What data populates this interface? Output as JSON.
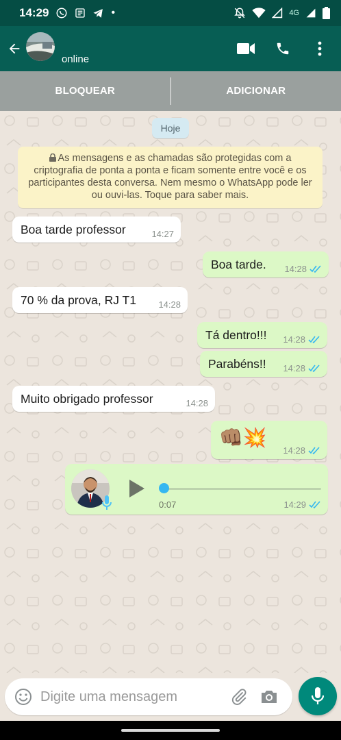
{
  "status": {
    "time": "14:29",
    "network": "4G"
  },
  "header": {
    "status": "online"
  },
  "actions": {
    "block": "BLOQUEAR",
    "add": "ADICIONAR"
  },
  "chat": {
    "date": "Hoje",
    "encryption_notice": "As mensagens e as chamadas são protegidas com a criptografia de ponta a ponta e ficam somente entre você e os participantes desta conversa. Nem mesmo o WhatsApp pode ler ou ouvi-las. Toque para saber mais.",
    "messages": [
      {
        "direction": "in",
        "text": "Boa tarde professor",
        "time": "14:27"
      },
      {
        "direction": "out",
        "text": "Boa tarde.",
        "time": "14:28",
        "read": true
      },
      {
        "direction": "in",
        "text": "70 % da prova, RJ T1",
        "time": "14:28"
      },
      {
        "direction": "out",
        "text": "Tá dentro!!!",
        "time": "14:28",
        "read": true
      },
      {
        "direction": "out",
        "text": "Parabéns!!",
        "time": "14:28",
        "read": true
      },
      {
        "direction": "in",
        "text": "Muito obrigado professor",
        "time": "14:28"
      },
      {
        "direction": "out",
        "text": "👊🏽💥",
        "time": "14:28",
        "read": true
      }
    ],
    "voice_note": {
      "duration": "0:07",
      "time": "14:29",
      "progress": 0,
      "read": true
    }
  },
  "composer": {
    "placeholder": "Digite uma mensagem"
  },
  "colors": {
    "header": "#075e54",
    "statusbar": "#054d44",
    "outgoing": "#dcf8c6",
    "incoming": "#ffffff",
    "read_ticks": "#34b7f1",
    "fab": "#00897b"
  }
}
